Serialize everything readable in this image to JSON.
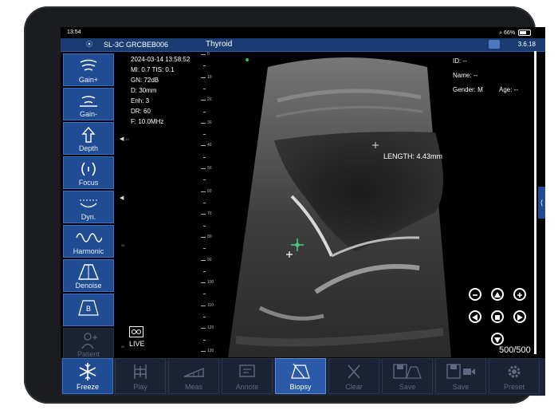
{
  "status_bar": {
    "time": "13:54",
    "battery": "66%"
  },
  "title_bar": {
    "probe": "SL-3C GRCBEB006",
    "preset": "Thyroid",
    "version": "3.6.18"
  },
  "sidebar": [
    {
      "label": "Gain+",
      "icon": "gain-plus-icon",
      "enabled": true
    },
    {
      "label": "Gain-",
      "icon": "gain-minus-icon",
      "enabled": true
    },
    {
      "label": "Depth",
      "icon": "depth-icon",
      "enabled": true
    },
    {
      "label": "Focus",
      "icon": "focus-icon",
      "enabled": true
    },
    {
      "label": "Dyn.",
      "icon": "dynamic-range-icon",
      "enabled": true
    },
    {
      "label": "Harmonic",
      "icon": "harmonic-icon",
      "enabled": true
    },
    {
      "label": "Denoise",
      "icon": "denoise-icon",
      "enabled": true
    },
    {
      "label": "",
      "icon": "b-mode-icon",
      "enabled": true
    },
    {
      "label": "Patient",
      "icon": "patient-icon",
      "enabled": false
    }
  ],
  "params": {
    "datetime": "2024-03-14 13:58:52",
    "mi_tis": "MI: 0.7  TIS: 0.1",
    "gain": "GN: 72dB",
    "depth": "D: 30mm",
    "enh": "Enh: 3",
    "dr": "DR: 60",
    "freq": "F: 10.0MHz"
  },
  "live_label": "LIVE",
  "ruler": [
    0,
    10,
    20,
    30,
    40,
    50,
    60,
    70,
    80,
    90,
    100,
    110,
    120,
    130
  ],
  "left_marks": [
    "10",
    "20",
    "30"
  ],
  "measurement": "LENGTH: 4.43mm",
  "patient_info": {
    "id": "ID: --",
    "name": "Name: --",
    "gender": "Gender: M",
    "age": "Age: --"
  },
  "frame_counter": "500/500",
  "bottom_bar": [
    {
      "label": "Freeze",
      "icon": "snowflake-icon",
      "state": "active"
    },
    {
      "label": "Play",
      "icon": "play-icon",
      "state": "disabled"
    },
    {
      "label": "Meas",
      "icon": "measure-icon",
      "state": "disabled"
    },
    {
      "label": "Annote",
      "icon": "annotate-icon",
      "state": "disabled"
    },
    {
      "label": "Biopsy",
      "icon": "biopsy-icon",
      "state": "selected"
    },
    {
      "label": "Clear",
      "icon": "clear-icon",
      "state": "disabled"
    },
    {
      "label": "Save",
      "icon": "save-image-icon",
      "state": "disabled"
    },
    {
      "label": "Save",
      "icon": "save-video-icon",
      "state": "disabled"
    },
    {
      "label": "Preset",
      "icon": "gear-icon",
      "state": "disabled"
    }
  ]
}
